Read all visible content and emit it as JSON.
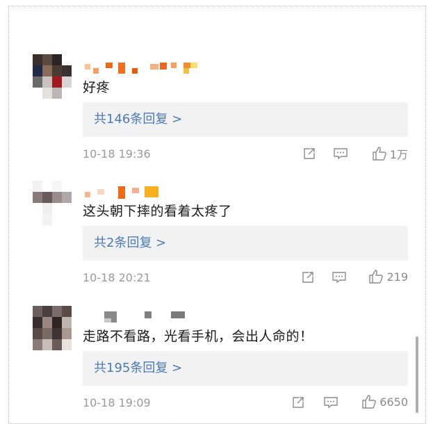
{
  "comments": [
    {
      "text": "好疼",
      "replies": "共146条回复 >",
      "time": "10-18 19:36",
      "likes": "1万"
    },
    {
      "text": "这头朝下摔的看着太疼了",
      "replies": "共2条回复 >",
      "time": "10-18 20:21",
      "likes": "219"
    },
    {
      "text": "走路不看路，光看手机，会出人命的！",
      "replies": "共195条回复 >",
      "time": "10-18 19:09",
      "likes": "6650"
    }
  ],
  "icons": {
    "share": "share-icon",
    "reply": "comment-icon",
    "like": "thumbs-up-icon"
  },
  "colors": {
    "link": "#4a7ab8",
    "reply_bg": "#f2f2f2",
    "meta": "#9a9a9a"
  }
}
